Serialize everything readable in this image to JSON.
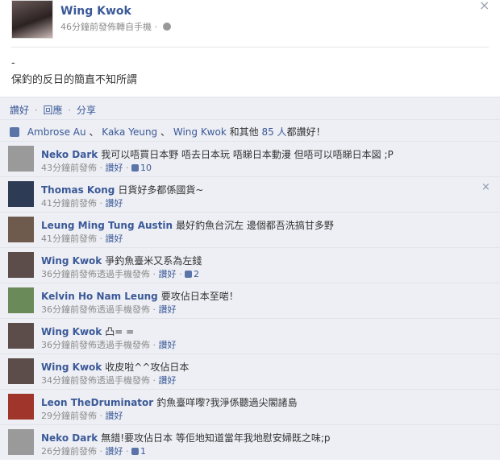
{
  "post": {
    "author": "Wing Kwok",
    "meta": "46分鐘前發佈轉自手機 ·",
    "body_line1": "-",
    "body_line2": "保釣的反日的簡直不知所謂"
  },
  "actions": {
    "like": "讚好",
    "comment": "回應",
    "share": "分享",
    "separator": "·"
  },
  "likes": {
    "user1": "Ambrose Au",
    "user2": "Kaka Yeung",
    "user3": "Wing Kwok",
    "separator": "、",
    "and_others": "和其他",
    "count_people": "85 人",
    "suffix": "都讚好！"
  },
  "comments": [
    {
      "author": "Neko Dark",
      "text": "我可以唔買日本野 唔去日本玩 唔睇日本動漫 但唔可以唔睇日本図 ;P",
      "time": "43分鐘前發佈",
      "like": "讚好",
      "likes": "10",
      "avatar_color": "#9a9a9a"
    },
    {
      "author": "Thomas Kong",
      "text": "日貨好多都係國貨~",
      "time": "41分鐘前發佈",
      "like": "讚好",
      "likes": "",
      "avatar_color": "#2d3b55"
    },
    {
      "author": "Leung Ming Tung Austin",
      "text": "最好釣魚台沉左 邊個都吾洗搞甘多野",
      "time": "41分鐘前發佈",
      "like": "讚好",
      "likes": "",
      "avatar_color": "#6f5a4e"
    },
    {
      "author": "Wing Kwok",
      "text": "爭釣魚臺米又系為左錢",
      "time": "36分鐘前發佈透過手機發佈",
      "like": "讚好",
      "likes": "2",
      "avatar_color": "#5c4c4a"
    },
    {
      "author": "Kelvin Ho Nam Leung",
      "text": "要攻佔日本至啱！",
      "time": "36分鐘前發佈透過手機發佈",
      "like": "讚好",
      "likes": "",
      "avatar_color": "#6b8a5a"
    },
    {
      "author": "Wing Kwok",
      "text": "凸= =",
      "time": "36分鐘前發佈透過手機發佈",
      "like": "讚好",
      "likes": "",
      "avatar_color": "#5c4c4a"
    },
    {
      "author": "Wing Kwok",
      "text": "收皮啦^^攻佔日本",
      "time": "34分鐘前發佈透過手機發佈",
      "like": "讚好",
      "likes": "",
      "avatar_color": "#5c4c4a"
    },
    {
      "author": "Leon TheDruminator",
      "text": "釣魚臺咩嚟?我淨係聽過尖閣諸島",
      "time": "29分鐘前發佈",
      "like": "讚好",
      "likes": "",
      "avatar_color": "#a0352c"
    },
    {
      "author": "Neko Dark",
      "text": "無錯!要攻佔日本 等佢地知道當年我地慰安婦既之味;p",
      "time": "26分鐘前發佈",
      "like": "讚好",
      "likes": "1",
      "avatar_color": "#9a9a9a"
    }
  ],
  "icons": {
    "close": "×",
    "thumb": "thumbs-up-icon",
    "globe": "globe-icon"
  }
}
